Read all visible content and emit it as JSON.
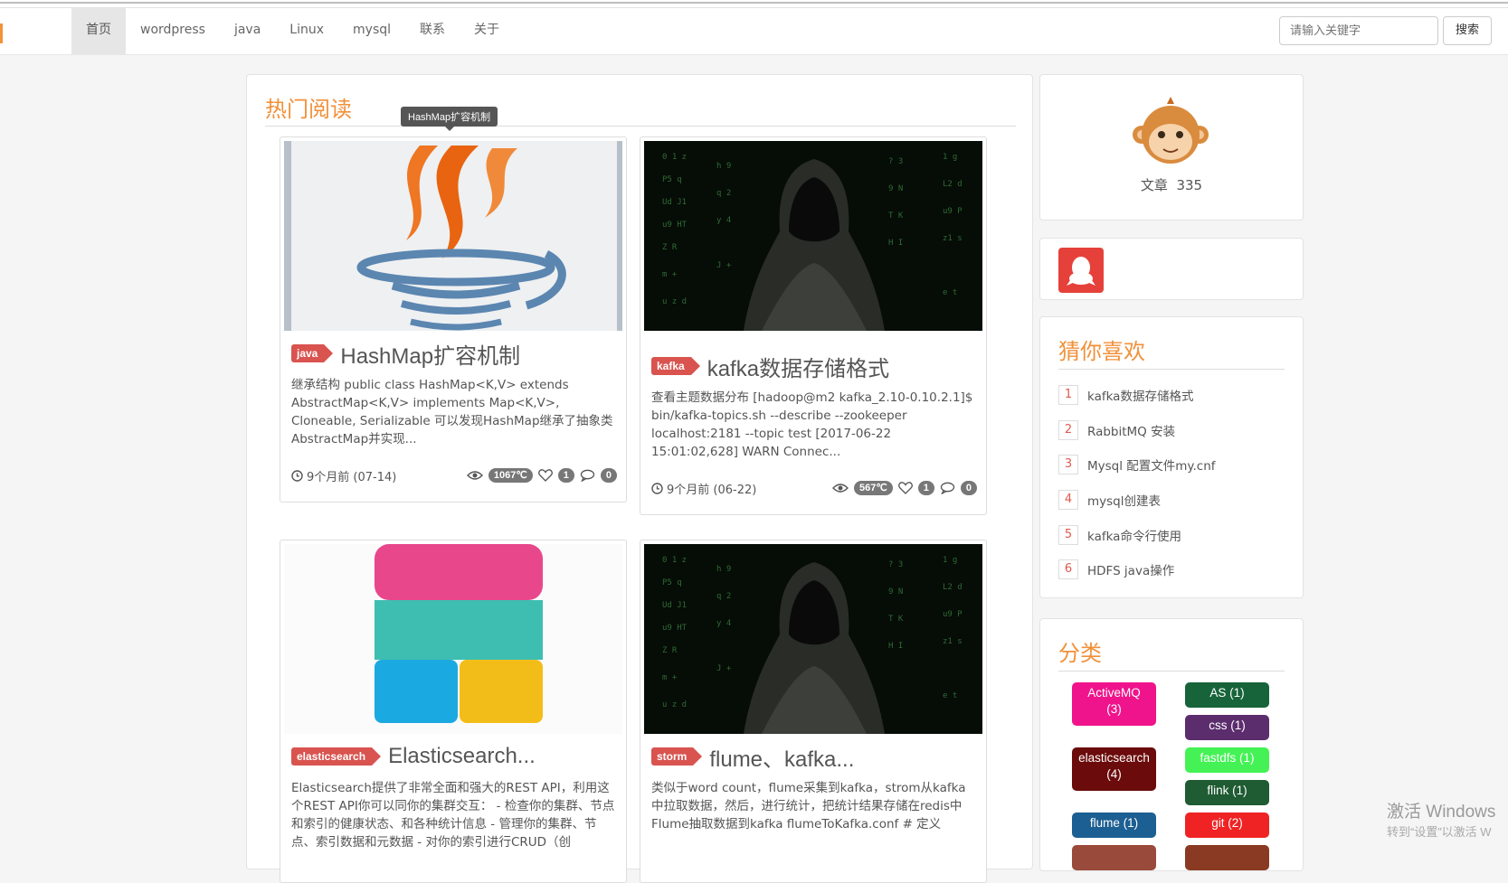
{
  "nav": {
    "items": [
      "首页",
      "wordpress",
      "java",
      "Linux",
      "mysql",
      "联系",
      "关于"
    ],
    "active_index": 0
  },
  "search": {
    "placeholder": "请输入关键字",
    "button": "搜索"
  },
  "hot": {
    "title": "热门阅读",
    "tooltip": "HashMap扩容机制",
    "cards": [
      {
        "tag": "java",
        "title": "HashMap扩容机制",
        "excerpt": "继承结构 public class HashMap<K,V> extends AbstractMap<K,V> implements Map<K,V>, Cloneable, Serializable 可以发现HashMap继承了抽象类AbstractMap并实现...",
        "time": "9个月前 (07-14)",
        "views": "1067℃",
        "likes": "1",
        "comments": "0"
      },
      {
        "tag": "kafka",
        "title": "kafka数据存储格式",
        "excerpt": "查看主题数据分布 [hadoop@m2 kafka_2.10-0.10.2.1]$ bin/kafka-topics.sh --describe --zookeeper localhost:2181 --topic test [2017-06-22 15:01:02,628] WARN Connec...",
        "time": "9个月前 (06-22)",
        "views": "567℃",
        "likes": "1",
        "comments": "0"
      },
      {
        "tag": "elasticsearch",
        "title": "Elasticsearch...",
        "excerpt": "Elasticsearch提供了非常全面和强大的REST API，利用这个REST API你可以同你的集群交互： - 检查你的集群、节点和索引的健康状态、和各种统计信息 - 管理你的集群、节点、索引数据和元数据 - 对你的索引进行CRUD（创"
      },
      {
        "tag": "storm",
        "title": "flume、kafka...",
        "excerpt": "类似于word count，flume采集到kafka，strom从kafka中拉取数据，然后，进行统计，把统计结果存储在redis中 Flume抽取数据到kafka flumeToKafka.conf # 定义"
      }
    ]
  },
  "profile": {
    "label": "文章",
    "count": "335"
  },
  "recommend": {
    "title": "猜你喜欢",
    "items": [
      {
        "num": "1",
        "text": "kafka数据存储格式"
      },
      {
        "num": "2",
        "text": "RabbitMQ 安装"
      },
      {
        "num": "3",
        "text": "Mysql 配置文件my.cnf"
      },
      {
        "num": "4",
        "text": "mysql创建表"
      },
      {
        "num": "5",
        "text": "kafka命令行使用"
      },
      {
        "num": "6",
        "text": "HDFS java操作"
      }
    ]
  },
  "categories": {
    "title": "分类",
    "items": [
      {
        "line1": "ActiveMQ",
        "line2": "(3)",
        "color": "#f0148c"
      },
      {
        "line1": "AS (1)",
        "color": "#17643a"
      },
      {
        "line1": "css (1)",
        "color": "#5c2d6d"
      },
      {
        "line1": "elasticsearch",
        "line2": "(4)",
        "color": "#6b0b0b"
      },
      {
        "line1": "fastdfs (1)",
        "color": "#44f255"
      },
      {
        "line1": "flink (1)",
        "color": "#1f5b33"
      },
      {
        "line1": "flume (1)",
        "color": "#1c5f92"
      },
      {
        "line1": "git (2)",
        "color": "#ef2323"
      }
    ]
  },
  "watermark": {
    "line1": "激活 Windows",
    "line2": "转到“设置”以激活 W"
  },
  "colors": {
    "accent": "#f0913a",
    "tag": "#d9534f",
    "badge": "#777777",
    "qq_red": "#e5413a"
  },
  "icons": [
    "clock-icon",
    "eye-icon",
    "heart-icon",
    "comment-icon",
    "monkey-avatar-icon",
    "qq-icon"
  ]
}
